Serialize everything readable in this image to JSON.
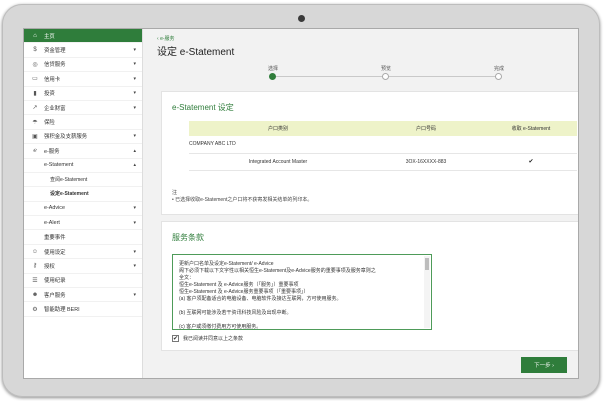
{
  "sidebar": {
    "items": [
      {
        "label": "主页",
        "icon": "home-icon",
        "glyph": "⌂",
        "active": true,
        "chev": ""
      },
      {
        "label": "资金管理",
        "icon": "dollar-icon",
        "glyph": "$",
        "chev": "▾"
      },
      {
        "label": "信贷服务",
        "icon": "coins-icon",
        "glyph": "◎",
        "chev": "▾"
      },
      {
        "label": "信用卡",
        "icon": "card-icon",
        "glyph": "▭",
        "chev": "▾"
      },
      {
        "label": "投资",
        "icon": "bar-chart-icon",
        "glyph": "▮",
        "chev": "▾"
      },
      {
        "label": "企业财富",
        "icon": "line-chart-icon",
        "glyph": "↗",
        "chev": "▾"
      },
      {
        "label": "保险",
        "icon": "umbrella-icon",
        "glyph": "☂",
        "chev": ""
      },
      {
        "label": "强积金及支薪服务",
        "icon": "briefcase-icon",
        "glyph": "▣",
        "chev": "▾"
      },
      {
        "label": "e-服务",
        "icon": "e-service-icon",
        "glyph": "ℯ",
        "chev": "▴"
      },
      {
        "label": "e-Statement",
        "level": 1,
        "chev": "▴"
      },
      {
        "label": "查阅e-Statement",
        "level": 2
      },
      {
        "label": "设定e-Statement",
        "level": 2,
        "current": true
      },
      {
        "label": "e-Advice",
        "level": 1,
        "chev": "▾"
      },
      {
        "label": "e-Alert",
        "level": 1,
        "chev": "▾"
      },
      {
        "label": "重要事件",
        "level": 1
      },
      {
        "label": "使用设定",
        "icon": "user-icon",
        "glyph": "☺",
        "chev": "▾"
      },
      {
        "label": "授权",
        "icon": "lock-icon",
        "glyph": "⚷",
        "chev": "▾"
      },
      {
        "label": "使用纪录",
        "icon": "history-icon",
        "glyph": "☰",
        "chev": ""
      },
      {
        "label": "客户服务",
        "icon": "person-icon",
        "glyph": "☻",
        "chev": "▾"
      },
      {
        "label": "智能助理 BERI",
        "icon": "robot-icon",
        "glyph": "⚙",
        "chev": ""
      }
    ]
  },
  "header": {
    "back_label": "e-服务",
    "title": "设定 e-Statement"
  },
  "steps": [
    {
      "label": "选择",
      "active": true
    },
    {
      "label": "预览",
      "active": false
    },
    {
      "label": "完成",
      "active": false
    }
  ],
  "estatement_card": {
    "title": "e-Statement 设定",
    "columns": [
      "户口类别",
      "户口号码",
      "收取 e-Statement"
    ],
    "company": "COMPANY ABC LTD",
    "rows": [
      {
        "type": "Integrated Account Master",
        "number": "3OX-16XXXX-883",
        "checked": true
      }
    ],
    "note_title": "注",
    "note_text": "• 已选择收取e-Statement之户口将不获寄发相关结单的列印本。"
  },
  "terms_card": {
    "title": "服务条款",
    "lines": [
      "更新户口名单及设定e-Statement/ e-Advice",
      "阁下必须下载以下文字性以相关恒生e-Statement及e-Advice服务的重要事项及服务章则之",
      "全文：",
      "恒生e-Statement 及 e-Advice服务（「服务」）重要事项",
      "恒生e-Statement 及 e-Advice服务重要事项（「重要事项」）",
      "(a) 客户须配备适合的电脑设备、电脑软件及接达互联网，方可使用服务。",
      "",
      "(b) 互联网可能涉及若干资讯科技风险及出现中断。",
      "",
      "(c) 客户或须缴付费用方可使用服务。"
    ],
    "agree_label": "我已阅读并同意以上之条款",
    "agree_checked": true
  },
  "next_button": {
    "label": "下一步 ›"
  }
}
